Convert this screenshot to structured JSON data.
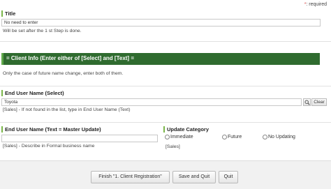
{
  "required_note": {
    "mark": "*",
    "text": ": required"
  },
  "title_section": {
    "label": "Title",
    "value": "No need to enter",
    "note": "Will be set after the 1 st Step is done."
  },
  "client_info": {
    "banner": "= Client Info (Enter either of [Select] and [Text] =",
    "note": "Only the case of future name change, enter both of them."
  },
  "end_user_select": {
    "label": "End User Name (Select)",
    "value": "Toyota",
    "clear_label": "Clear",
    "search_icon": "magnifier-icon",
    "note": "[Sales] - If not found in the list, type in End User Name (Text)"
  },
  "end_user_text": {
    "label": "End User Name (Text = Master Update)",
    "value": "",
    "note": "[Sales] - Describe in Formal business name"
  },
  "update_category": {
    "label": "Update Category",
    "options": [
      "Immediate",
      "Future",
      "No Updating"
    ],
    "note": "[Sales]"
  },
  "footer": {
    "finish_label": "Finish \"1. Client Registration\"",
    "save_quit_label": "Save and Quit",
    "quit_label": "Quit"
  },
  "colors": {
    "banner_bg": "#2f6b2f",
    "accent_green": "#7ab648",
    "required_star": "#d9534f"
  }
}
